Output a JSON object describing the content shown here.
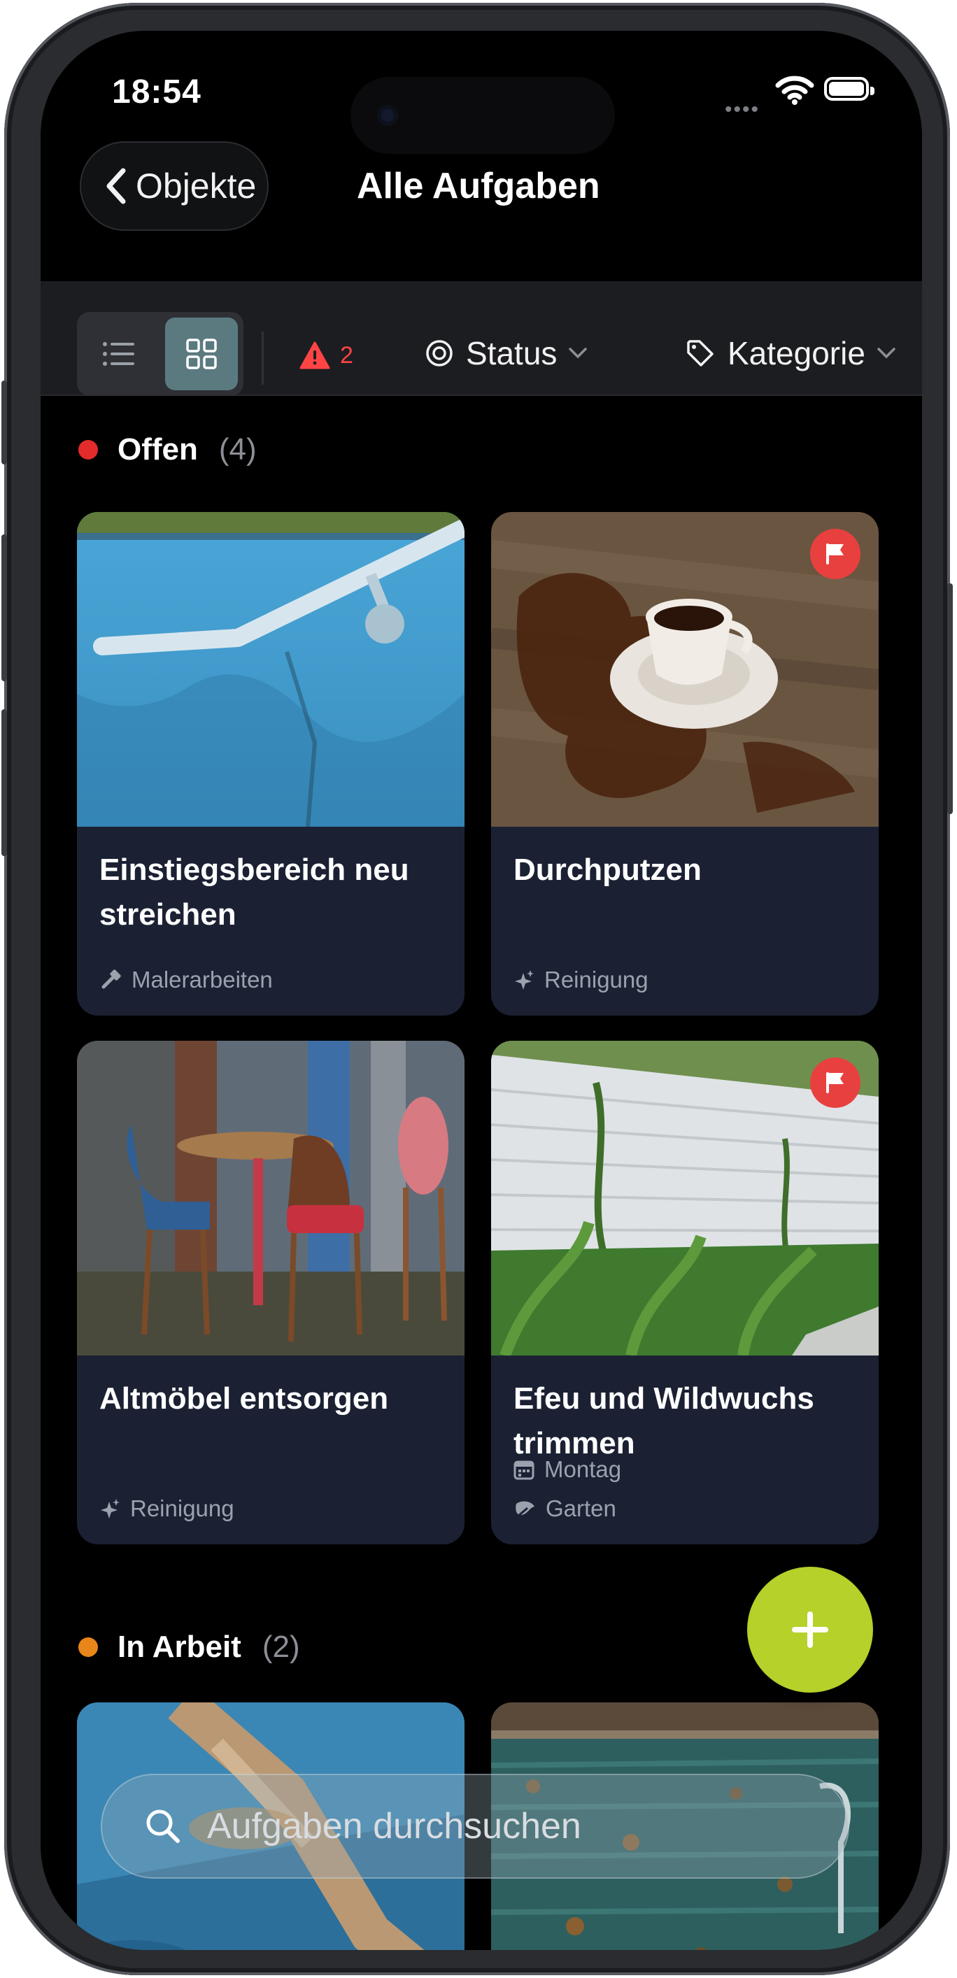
{
  "status_bar": {
    "time": "18:54"
  },
  "nav": {
    "back_label": "Objekte",
    "title": "Alle Aufgaben"
  },
  "toolbar": {
    "view_modes": [
      "list",
      "grid"
    ],
    "selected_view": "grid",
    "alert_count": "2",
    "filters": [
      {
        "label": "Status",
        "icon": "target-icon"
      },
      {
        "label": "Kategorie",
        "icon": "tag-icon"
      }
    ]
  },
  "sections": [
    {
      "name": "Offen",
      "count": "(4)",
      "color": "#e32b2b",
      "cards": [
        {
          "title": "Einstiegsbereich neu streichen",
          "meta": [
            {
              "icon": "paint-roller-icon",
              "text": "Malerarbeiten"
            }
          ],
          "flagged": false,
          "image": "blue-pool-wall-with-handrail"
        },
        {
          "title": "Durchputzen",
          "meta": [
            {
              "icon": "sparkle-icon",
              "text": "Reinigung"
            }
          ],
          "flagged": true,
          "image": "spilled-coffee-cup-on-table"
        },
        {
          "title": "Altmöbel entsorgen",
          "meta": [
            {
              "icon": "sparkle-icon",
              "text": "Reinigung"
            }
          ],
          "flagged": false,
          "image": "old-chairs-and-table"
        },
        {
          "title": "Efeu und Wildwuchs trimmen",
          "meta": [
            {
              "icon": "calendar-icon",
              "text": "Montag"
            },
            {
              "icon": "leaf-icon",
              "text": "Garten"
            }
          ],
          "flagged": true,
          "image": "white-fence-with-plants"
        }
      ]
    },
    {
      "name": "In Arbeit",
      "count": "(2)",
      "color": "#e8861a",
      "cards": [
        {
          "image": "pool-edge-blue-water"
        },
        {
          "image": "pool-with-leaves"
        }
      ]
    }
  ],
  "search": {
    "placeholder": "Aufgaben durchsuchen"
  },
  "colors": {
    "accent_fab": "#b5d12a",
    "card_bg": "#1b2133",
    "flag": "#e8403f",
    "alert": "#ff4444"
  }
}
